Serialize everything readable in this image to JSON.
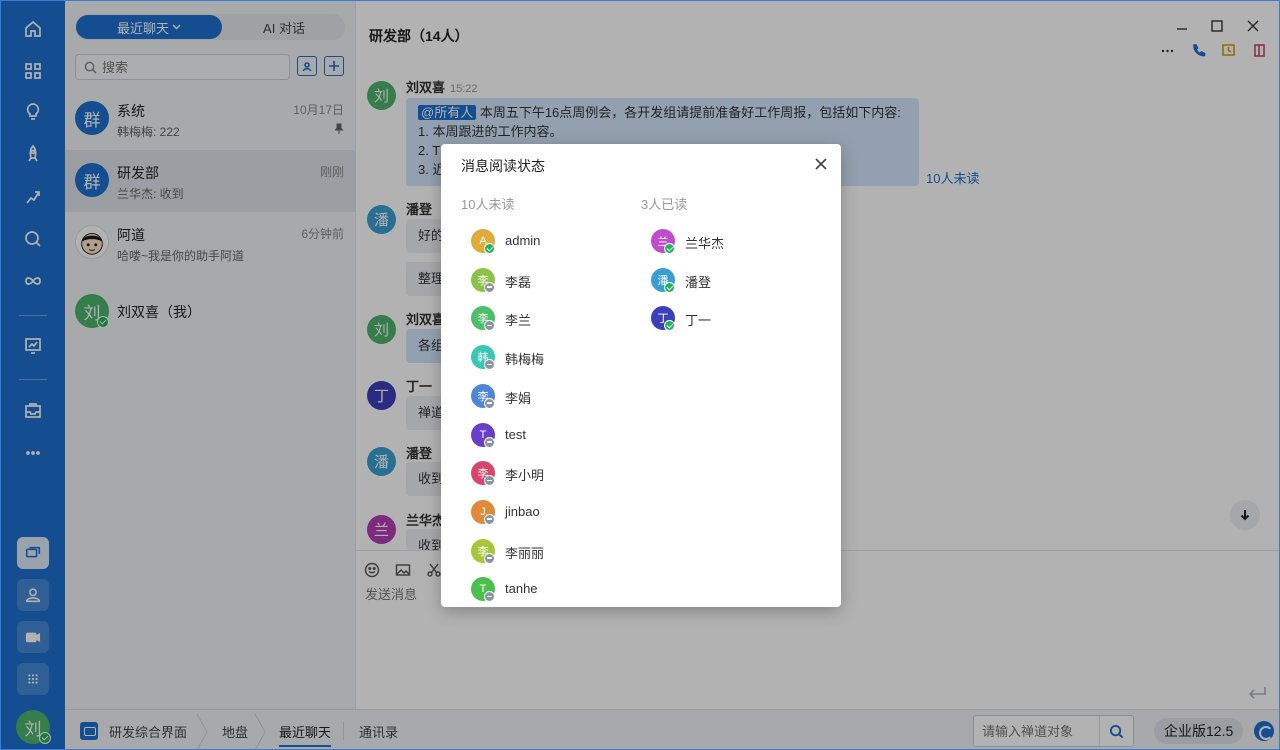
{
  "tabs": {
    "recent": "最近聊天",
    "ai": "AI 对话"
  },
  "search": {
    "placeholder": "搜索"
  },
  "conversations": [
    {
      "name": "系统",
      "preview": "韩梅梅: 222",
      "time": "10月17日",
      "avatar": "群",
      "color": "#1d6fce"
    },
    {
      "name": "研发部",
      "preview": "兰华杰: 收到",
      "time": "刚刚",
      "avatar": "群",
      "color": "#1d6fce"
    },
    {
      "name": "阿道",
      "preview": "哈喽~我是你的助手阿道",
      "time": "6分钟前",
      "avatar": "",
      "color": "#ffffff"
    },
    {
      "name": "刘双喜（我）",
      "preview": "",
      "time": "",
      "avatar": "刘",
      "color": "#4db36a"
    }
  ],
  "chat": {
    "title": "研发部（14人）",
    "messages": [
      {
        "sender": "刘双喜",
        "time": "15:22",
        "avatar": "刘",
        "color": "#4db36a",
        "at": "@所有人",
        "line1": "本周五下午16点周例会，各开发组请提前准备好工作周报，包括如下内容:",
        "line2": "1. 本周跟进的工作内容。",
        "line3": "2. T",
        "line4": "3. 近"
      },
      {
        "sender": "潘登",
        "avatar": "潘",
        "color": "#3a9fd0",
        "text": "好的",
        "text2": "整理"
      },
      {
        "sender": "刘双喜",
        "avatar": "刘",
        "color": "#4db36a",
        "text": "各组"
      },
      {
        "sender": "丁一",
        "avatar": "丁",
        "color": "#3b3fb8",
        "text": "禅道"
      },
      {
        "sender": "潘登",
        "avatar": "潘",
        "color": "#3a9fd0",
        "text": "收到"
      },
      {
        "sender": "兰华杰",
        "avatar": "兰",
        "color": "#b53db5",
        "text": "收到"
      }
    ],
    "unread_link": "10人未读",
    "compose_placeholder": "发送消息"
  },
  "modal": {
    "title": "消息阅读状态",
    "unread_header": "10人未读",
    "read_header": "3人已读",
    "unread": [
      {
        "name": "admin",
        "initial": "A",
        "color": "#e2a93b",
        "status": "online"
      },
      {
        "name": "李磊",
        "initial": "李",
        "color": "#8bc34a",
        "status": "offline"
      },
      {
        "name": "李兰",
        "initial": "李",
        "color": "#4cbf6a",
        "status": "offline"
      },
      {
        "name": "韩梅梅",
        "initial": "韩",
        "color": "#3cc6b4",
        "status": "offline"
      },
      {
        "name": "李娟",
        "initial": "李",
        "color": "#4f86d8",
        "status": "offline"
      },
      {
        "name": "test",
        "initial": "T",
        "color": "#6a3fc8",
        "status": "offline"
      },
      {
        "name": "李小明",
        "initial": "李",
        "color": "#d8456b",
        "status": "offline"
      },
      {
        "name": "jinbao",
        "initial": "J",
        "color": "#e08a3a",
        "status": "offline"
      },
      {
        "name": "李丽丽",
        "initial": "李",
        "color": "#a8c63a",
        "status": "offline"
      },
      {
        "name": "tanhe",
        "initial": "T",
        "color": "#4cbf4c",
        "status": "offline"
      }
    ],
    "read": [
      {
        "name": "兰华杰",
        "initial": "兰",
        "color": "#c24ad0",
        "status": "online"
      },
      {
        "name": "潘登",
        "initial": "潘",
        "color": "#3a9fd0",
        "status": "online"
      },
      {
        "name": "丁一",
        "initial": "丁",
        "color": "#3b3fb8",
        "status": "online"
      }
    ]
  },
  "bottombar": {
    "workspace": "研发综合界面",
    "items": [
      "地盘",
      "最近聊天",
      "通讯录"
    ],
    "search_placeholder": "请输入禅道对象",
    "edition": "企业版12.5"
  },
  "me": {
    "avatar": "刘"
  }
}
